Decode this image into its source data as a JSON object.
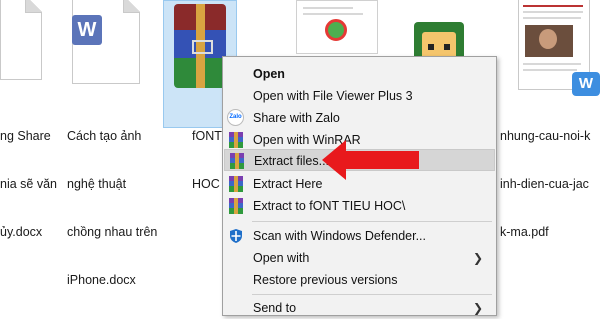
{
  "files": [
    {
      "label_lines": [
        "ng Share",
        "nia sẽ văn",
        "ủy.docx"
      ]
    },
    {
      "label_lines": [
        "Cách tạo ảnh",
        "nghệ thuật",
        "chồng nhau trên",
        "iPhone.docx"
      ],
      "icon": "word-icon"
    },
    {
      "label_lines": [
        "fONT",
        "HOC"
      ],
      "icon": "winrar-archive-icon"
    },
    {
      "label_lines": [
        "nhung-cau-noi-k",
        "inh-dien-cua-jac",
        "k-ma.pdf"
      ],
      "icon": "pdf-icon"
    }
  ],
  "context_menu": {
    "items": [
      {
        "label": "Open",
        "bold": true,
        "icon": ""
      },
      {
        "label": "Open with File Viewer Plus 3",
        "icon": ""
      },
      {
        "label": "Share with Zalo",
        "icon": "zalo-icon"
      },
      {
        "label": "Open with WinRAR",
        "icon": "winrar-icon"
      },
      {
        "label": "Extract files...",
        "icon": "winrar-icon",
        "highlighted": true
      },
      {
        "label": "Extract Here",
        "icon": "winrar-icon"
      },
      {
        "label": "Extract to fONT TIEU HOC\\",
        "icon": "winrar-icon"
      },
      {
        "label": "Scan with Windows Defender...",
        "icon": "windows-defender-icon"
      },
      {
        "label": "Open with",
        "icon": "",
        "submenu": true
      },
      {
        "label": "Restore previous versions",
        "icon": ""
      },
      {
        "label": "Send to",
        "icon": "",
        "submenu": true
      }
    ]
  },
  "annotation": {
    "arrow_color": "#e8191c"
  },
  "colors": {
    "selection": "#cce4f7",
    "menu_bg": "#f2f2f2",
    "highlight": "#d6d6d6"
  }
}
